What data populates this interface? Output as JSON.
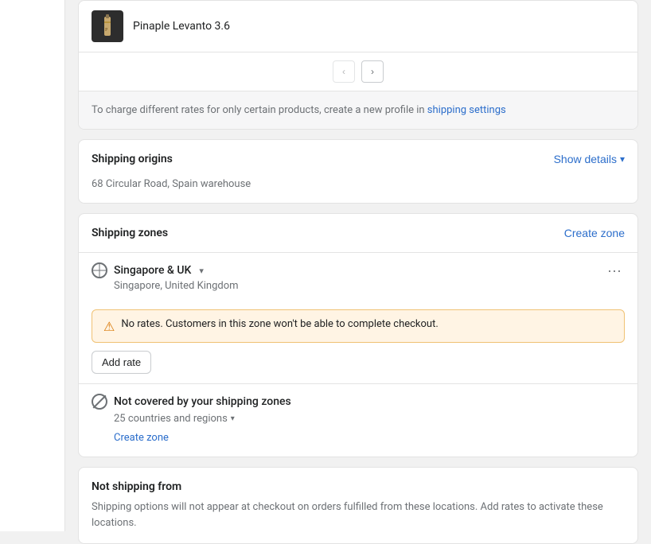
{
  "sidebar": {
    "visible": true
  },
  "product_card": {
    "thumbnail_alt": "Pinaple Levanto product image",
    "product_name": "Pinaple Levanto 3.6"
  },
  "pagination": {
    "prev_label": "‹",
    "next_label": "›"
  },
  "settings_note": {
    "text_before": "To charge different rates for only certain products, create a new profile in ",
    "link_text": "shipping settings",
    "text_after": ""
  },
  "shipping_origins": {
    "title": "Shipping origins",
    "show_details_label": "Show details",
    "chevron": "▾",
    "address": "68 Circular Road, Spain warehouse"
  },
  "shipping_zones": {
    "title": "Shipping zones",
    "create_zone_label": "Create zone",
    "zone": {
      "name": "Singapore & UK",
      "chevron": "▾",
      "countries": "Singapore, United Kingdom",
      "warning": "No rates. Customers in this zone won't be able to complete checkout.",
      "add_rate_label": "Add rate"
    },
    "not_covered": {
      "title": "Not covered by your shipping zones",
      "countries_count": "25 countries and regions",
      "countries_chevron": "▾",
      "create_zone_label": "Create zone"
    }
  },
  "not_shipping_from": {
    "title": "Not shipping from",
    "description": "Shipping options will not appear at checkout on orders fulfilled from these locations. Add rates to activate these locations."
  }
}
